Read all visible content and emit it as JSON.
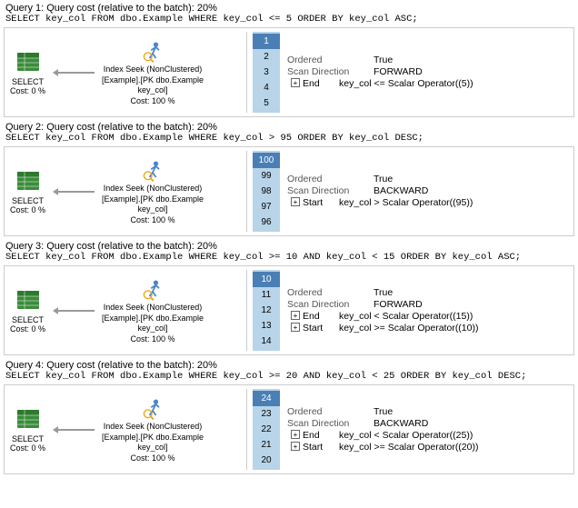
{
  "queries": [
    {
      "id": "query1",
      "title": "Query 1: Query cost (relative to the batch): 20%",
      "sql": "SELECT key_col FROM dbo.Example WHERE key_col <= 5 ORDER BY key_col ASC;",
      "select_label": "SELECT",
      "select_cost": "Cost: 0 %",
      "seek_title": "Index Seek (NonClustered)",
      "seek_detail": "[Example].[PK dbo.Example key_col]",
      "seek_cost": "Cost: 100 %",
      "numbers": [
        {
          "val": "1",
          "highlight": true
        },
        {
          "val": "2",
          "highlight": false
        },
        {
          "val": "3",
          "highlight": false
        },
        {
          "val": "4",
          "highlight": false
        },
        {
          "val": "5",
          "highlight": false
        }
      ],
      "props": [
        {
          "key": "Ordered",
          "value": "True"
        },
        {
          "key": "Scan Direction",
          "value": "FORWARD"
        },
        {
          "icon": "+",
          "label": "End",
          "value": "key_col <= Scalar Operator((5))"
        }
      ]
    },
    {
      "id": "query2",
      "title": "Query 2: Query cost (relative to the batch): 20%",
      "sql": "SELECT key_col FROM dbo.Example WHERE key_col > 95 ORDER BY key_col DESC;",
      "select_label": "SELECT",
      "select_cost": "Cost: 0 %",
      "seek_title": "Index Seek (NonClustered)",
      "seek_detail": "[Example].[PK dbo.Example key_col]",
      "seek_cost": "Cost: 100 %",
      "numbers": [
        {
          "val": "100",
          "highlight": true
        },
        {
          "val": "99",
          "highlight": false
        },
        {
          "val": "98",
          "highlight": false
        },
        {
          "val": "97",
          "highlight": false
        },
        {
          "val": "96",
          "highlight": false
        }
      ],
      "props": [
        {
          "key": "Ordered",
          "value": "True"
        },
        {
          "key": "Scan Direction",
          "value": "BACKWARD"
        },
        {
          "icon": "+",
          "label": "Start",
          "value": "key_col > Scalar Operator((95))"
        }
      ]
    },
    {
      "id": "query3",
      "title": "Query 3: Query cost (relative to the batch): 20%",
      "sql": "SELECT key_col FROM dbo.Example WHERE key_col >= 10 AND key_col < 15 ORDER BY key_col ASC;",
      "select_label": "SELECT",
      "select_cost": "Cost: 0 %",
      "seek_title": "Index Seek (NonClustered)",
      "seek_detail": "[Example].[PK dbo.Example key_col]",
      "seek_cost": "Cost: 100 %",
      "numbers": [
        {
          "val": "10",
          "highlight": true
        },
        {
          "val": "11",
          "highlight": false
        },
        {
          "val": "12",
          "highlight": false
        },
        {
          "val": "13",
          "highlight": false
        },
        {
          "val": "14",
          "highlight": false
        }
      ],
      "props": [
        {
          "key": "Ordered",
          "value": "True"
        },
        {
          "key": "Scan Direction",
          "value": "FORWARD"
        },
        {
          "icon": "+",
          "label": "End",
          "value": "key_col < Scalar Operator((15))"
        },
        {
          "icon": "+",
          "label": "Start",
          "value": "key_col >= Scalar Operator((10))"
        }
      ]
    },
    {
      "id": "query4",
      "title": "Query 4: Query cost (relative to the batch): 20%",
      "sql": "SELECT key_col FROM dbo.Example WHERE key_col >= 20 AND key_col < 25 ORDER BY key_col DESC;",
      "select_label": "SELECT",
      "select_cost": "Cost: 0 %",
      "seek_title": "Index Seek (NonClustered)",
      "seek_detail": "[Example].[PK dbo.Example key_col]",
      "seek_cost": "Cost: 100 %",
      "numbers": [
        {
          "val": "24",
          "highlight": true
        },
        {
          "val": "23",
          "highlight": false
        },
        {
          "val": "22",
          "highlight": false
        },
        {
          "val": "21",
          "highlight": false
        },
        {
          "val": "20",
          "highlight": false
        }
      ],
      "props": [
        {
          "key": "Ordered",
          "value": "True"
        },
        {
          "key": "Scan Direction",
          "value": "BACKWARD"
        },
        {
          "icon": "+",
          "label": "End",
          "value": "key_col < Scalar Operator((25))"
        },
        {
          "icon": "+",
          "label": "Start",
          "value": "key_col >= Scalar Operator((20))"
        }
      ]
    }
  ]
}
